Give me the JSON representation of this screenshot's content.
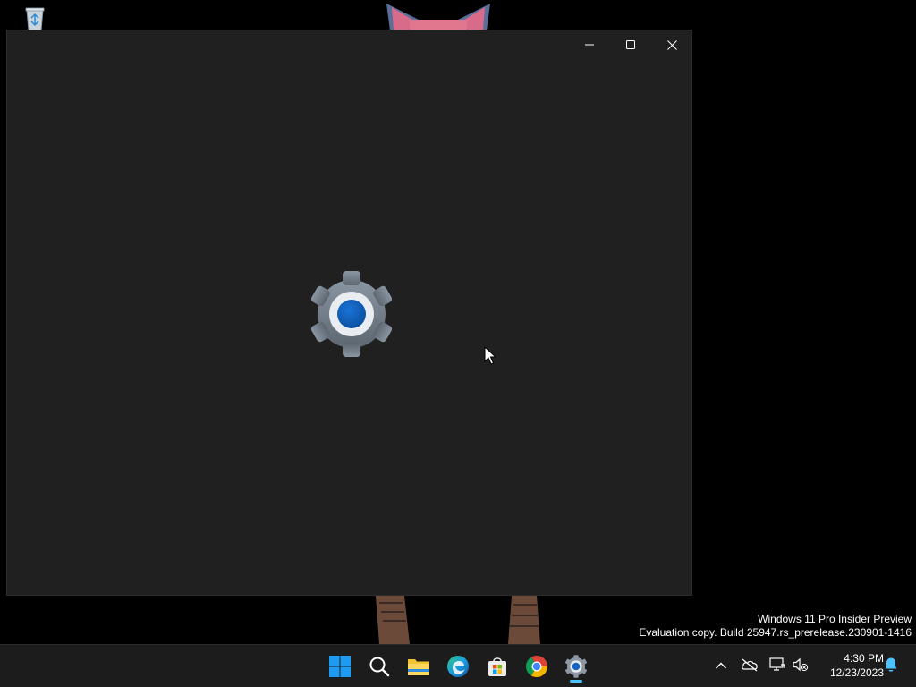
{
  "desktop": {
    "icons": [
      {
        "name": "Recycle Bin",
        "icon": "recycle-bin-icon"
      }
    ],
    "watermark": {
      "line1": "Windows 11 Pro Insider Preview",
      "line2": "Evaluation copy. Build 25947.rs_prerelease.230901-1416"
    }
  },
  "window": {
    "app_icon": "settings-gear-icon",
    "caption_buttons": [
      "minimize-icon",
      "maximize-icon",
      "close-icon"
    ],
    "background": "#202020"
  },
  "taskbar": {
    "pinned": [
      {
        "name": "start",
        "icon": "windows-logo-icon"
      },
      {
        "name": "search",
        "icon": "search-icon"
      },
      {
        "name": "file-explorer",
        "icon": "folder-icon"
      },
      {
        "name": "edge",
        "icon": "edge-icon"
      },
      {
        "name": "microsoft-store",
        "icon": "store-icon"
      },
      {
        "name": "chrome",
        "icon": "chrome-icon"
      },
      {
        "name": "settings",
        "icon": "settings-gear-icon",
        "active": true
      }
    ],
    "tray": {
      "icons": [
        "chevron-up-icon",
        "onedrive-icon",
        "network-icon",
        "volume-muted-icon",
        "notification-bell-icon"
      ],
      "time": "4:30 PM",
      "date": "12/23/2023"
    },
    "accent_color": "#4cc2ff"
  }
}
